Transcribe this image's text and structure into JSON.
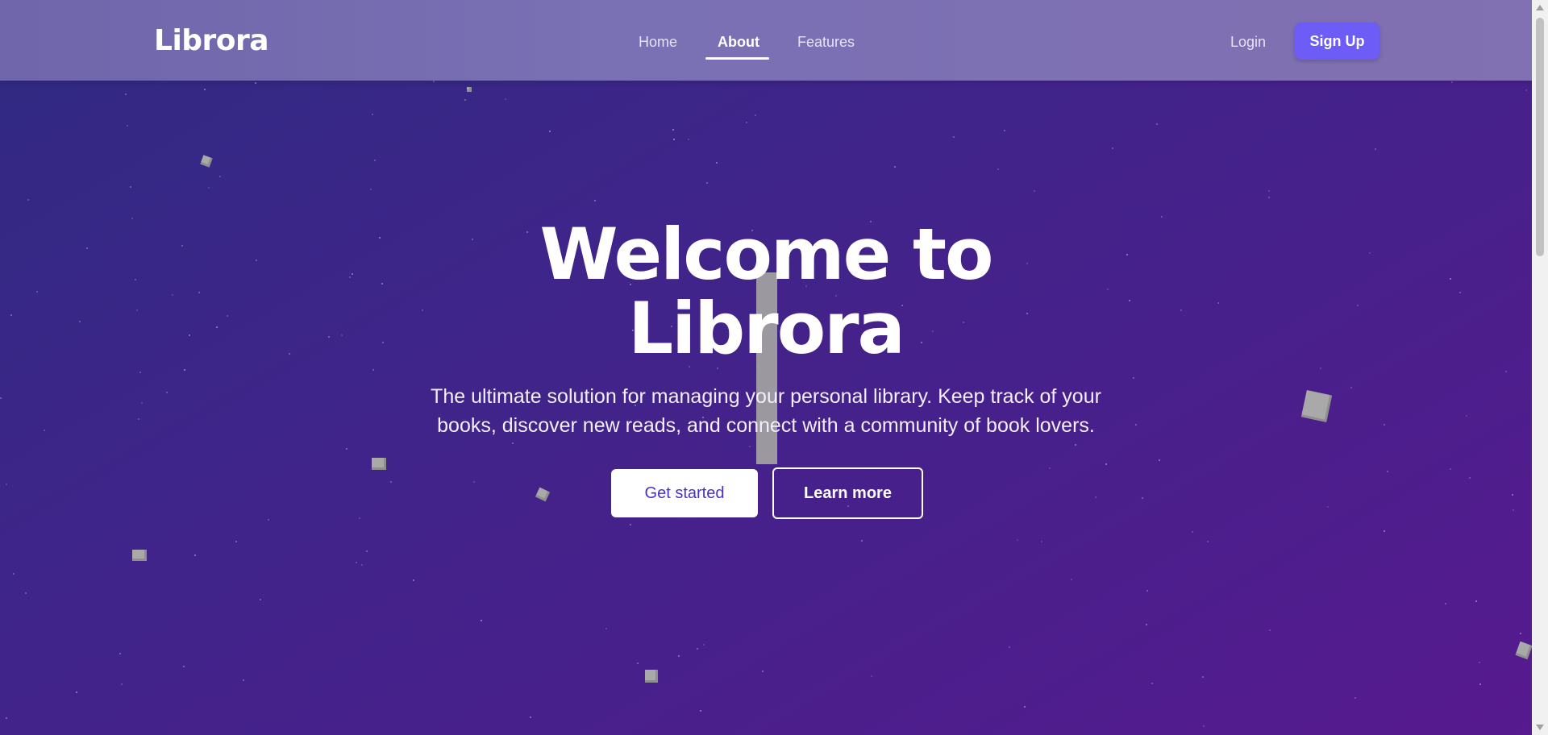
{
  "navbar": {
    "logo": "Librora",
    "links": [
      {
        "label": "Home"
      },
      {
        "label": "About",
        "active": true
      },
      {
        "label": "Features"
      }
    ],
    "login_label": "Login",
    "signup_label": "Sign Up"
  },
  "hero": {
    "title_line1": "Welcome to",
    "title_line2": "Librora",
    "subtitle_line1": "The ultimate solution for managing your personal library. Keep track of your",
    "subtitle_line2": "books, discover new reads, and connect with a community of book lovers.",
    "primary_button": "Get started",
    "secondary_button": "Learn more"
  },
  "colors": {
    "background_start": "#2f2a82",
    "background_end": "#571a8f",
    "accent": "#6d5cf6",
    "primary_button_text": "#4a2fc8"
  }
}
